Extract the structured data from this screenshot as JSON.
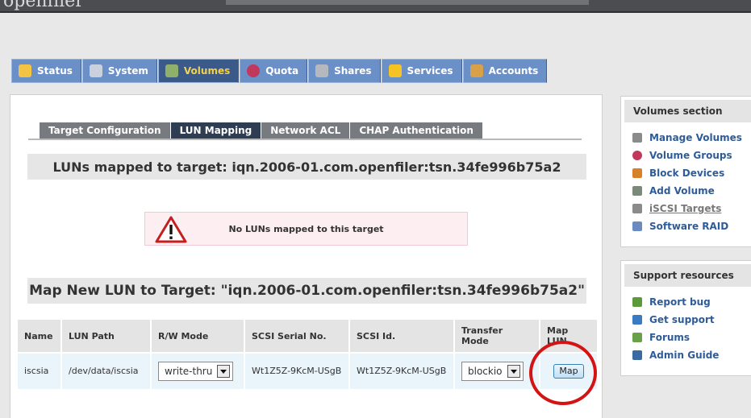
{
  "app": {
    "logo_text": "openfiler"
  },
  "main_tabs": [
    {
      "label": "Status",
      "icon": "weather-icon",
      "color": "#f3c443"
    },
    {
      "label": "System",
      "icon": "computer-icon",
      "color": "#c9d2dc"
    },
    {
      "label": "Volumes",
      "icon": "disk-icon",
      "color": "#8fb06a"
    },
    {
      "label": "Quota",
      "icon": "pie-chart-icon",
      "color": "#c0395a"
    },
    {
      "label": "Shares",
      "icon": "server-icon",
      "color": "#b5b8bc"
    },
    {
      "label": "Services",
      "icon": "lightning-icon",
      "color": "#f5c323"
    },
    {
      "label": "Accounts",
      "icon": "users-icon",
      "color": "#d9a04a"
    }
  ],
  "sub_tabs": [
    {
      "label": "Target Configuration"
    },
    {
      "label": "LUN Mapping"
    },
    {
      "label": "Network ACL"
    },
    {
      "label": "CHAP Authentication"
    }
  ],
  "mapped_section": {
    "title": "LUNs mapped to target: iqn.2006-01.com.openfiler:tsn.34fe996b75a2",
    "empty_message": "No LUNs mapped to this target"
  },
  "map_section": {
    "title": "Map New LUN to Target: \"iqn.2006-01.com.openfiler:tsn.34fe996b75a2\""
  },
  "lun_table": {
    "headers": [
      "Name",
      "LUN Path",
      "R/W Mode",
      "SCSI Serial No.",
      "SCSI Id.",
      "Transfer Mode",
      "Map LUN"
    ],
    "row": {
      "name": "iscsia",
      "lun_path": "/dev/data/iscsia",
      "rw_mode": "write-thru",
      "scsi_serial": "Wt1Z5Z-9KcM-USgB",
      "scsi_id": "Wt1Z5Z-9KcM-USgB",
      "transfer_mode": "blockio",
      "map_label": "Map"
    }
  },
  "volumes_section": {
    "title": "Volumes section",
    "items": [
      {
        "label": "Manage Volumes",
        "icon": "disk-icon",
        "color": "#8a8a8a"
      },
      {
        "label": "Volume Groups",
        "icon": "pie-chart-icon",
        "color": "#c0395a"
      },
      {
        "label": "Block Devices",
        "icon": "block-device-icon",
        "color": "#d8802a"
      },
      {
        "label": "Add Volume",
        "icon": "add-disk-icon",
        "color": "#7a8a7a"
      },
      {
        "label": "iSCSI Targets",
        "icon": "iscsi-icon",
        "color": "#8a8a8a"
      },
      {
        "label": "Software RAID",
        "icon": "raid-icon",
        "color": "#6a8ac0"
      }
    ]
  },
  "support_section": {
    "title": "Support resources",
    "items": [
      {
        "label": "Report bug",
        "icon": "bug-icon",
        "color": "#5a9a3a"
      },
      {
        "label": "Get support",
        "icon": "support-icon",
        "color": "#3a7ac0"
      },
      {
        "label": "Forums",
        "icon": "forum-icon",
        "color": "#6aa04a"
      },
      {
        "label": "Admin Guide",
        "icon": "book-icon",
        "color": "#3a6aa0"
      }
    ]
  },
  "colors": {
    "highlight_circle": "#d41414",
    "active_tab_text": "#f2d24a",
    "link": "#2f5c98"
  }
}
